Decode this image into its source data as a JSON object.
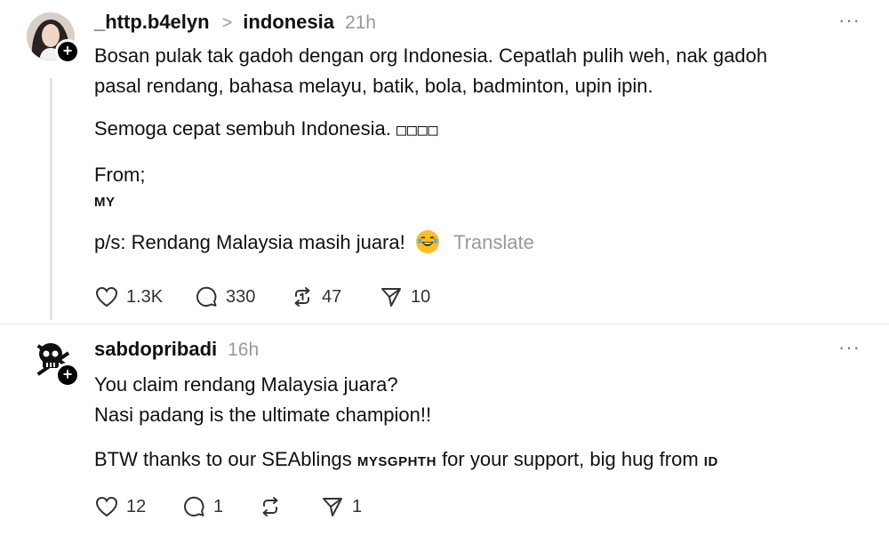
{
  "post1": {
    "username": "_http.b4elyn",
    "topic": "indonesia",
    "time": "21h",
    "line1": "Bosan pulak tak gadoh dengan org Indonesia. Cepatlah pulih weh, nak gadoh",
    "line2": "pasal rendang, bahasa melayu, batik, bola, badminton, upin ipin.",
    "line3": "Semoga cepat sembuh Indonesia.",
    "line3_glyphs": "□□□□",
    "line4": "From;",
    "line5": "MY",
    "line6": "p/s: Rendang Malaysia masih juara!",
    "translate": "Translate",
    "likes": "1.3K",
    "comments": "330",
    "reposts": "47",
    "shares": "10"
  },
  "post2": {
    "username": "sabdopribadi",
    "time": "16h",
    "line1": "You claim rendang Malaysia juara?",
    "line2": "Nasi padang is the ultimate champion!!",
    "line3_a": "BTW thanks to our SEAblings",
    "line3_b": "MYSGPHTH",
    "line3_c": "for your support, big hug from",
    "line3_d": "ID",
    "likes": "12",
    "comments": "1",
    "shares": "1"
  },
  "ui": {
    "more": "···",
    "plus": "+",
    "chevron": ">"
  }
}
